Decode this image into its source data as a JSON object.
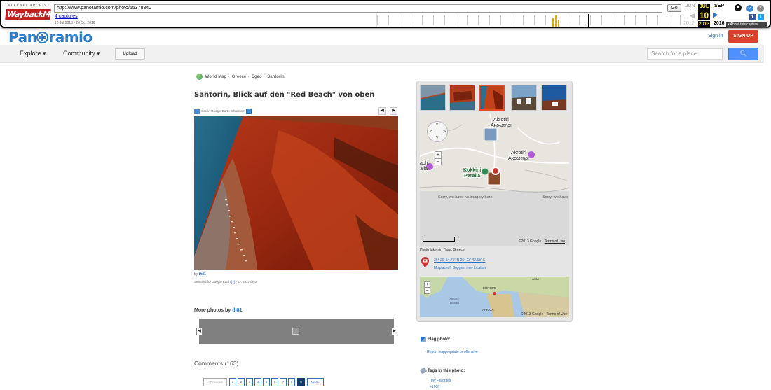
{
  "wayback": {
    "ia_label": "INTERNET ARCHIVE",
    "logo": "WaybackMachine",
    "url": "http://www.panoramio.com/photo/55378840",
    "go_label": "Go",
    "captures": "4 captures",
    "range": "10 Jul 2013 - 20 Oct 2016",
    "months": {
      "prev": "JUN",
      "current": "JUL",
      "next": "SEP"
    },
    "day": "10",
    "years": {
      "prev": "2012",
      "current": "2013",
      "next": "2016"
    },
    "about": "About this capture"
  },
  "header": {
    "logo_pre": "Pan",
    "logo_post": "ramio",
    "signin": "Sign in",
    "signup": "SIGN UP"
  },
  "nav": {
    "explore": "Explore ▾",
    "community": "Community ▾",
    "upload": "Upload",
    "search_placeholder": "Search for a place",
    "search_icon": "search-icon"
  },
  "breadcrumb": [
    "World Map",
    "Greece",
    "Egeo",
    "Santorini"
  ],
  "photo": {
    "title": "Santorin, Blick auf den \"Red Beach\" von oben",
    "see_in_ge": "See in Google Earth",
    "share_on": "Share on:",
    "by_prefix": "by ",
    "author": "th81",
    "selected": "Selected for Google Earth",
    "selected_q": "[?]",
    "id_text": " - ID: 55378840"
  },
  "more_photos": {
    "title_prefix": "More photos by ",
    "author": "th81"
  },
  "comments": {
    "title": "Comments (163)",
    "prev": "« Previous",
    "pages": [
      "1",
      "2",
      "3",
      "4",
      "5",
      "6",
      "7",
      "8",
      "9"
    ],
    "current_page": "9",
    "next": "Next »"
  },
  "side": {
    "map_labels": {
      "akrotiri_top": "Akrotiri\nΑκρωτήρι",
      "akrotiri_right": "Akrotiri\nΑκρωτήρι",
      "kokkini": "Kokkini\nParalia",
      "left_cut": "ach\nalia"
    },
    "no_imagery_1": "Sorry, we have no imagery here.",
    "no_imagery_2": "Sorry, we have",
    "map_copyright": "©2013 Google - ",
    "terms": "Terms of Use",
    "taken": "Photo taken in Thira, Greece",
    "coords": "36° 20' 54.71\" N  25° 23' 42.63\" E",
    "misplaced": "Misplaced? Suggest new location",
    "world_labels": {
      "asia": "ASIA",
      "europe": "EUROPE",
      "atlantic": "Atlantic\nOcean",
      "africa": "AFRICA"
    },
    "world_copyright": "©2013 Google - "
  },
  "flag": {
    "title": "Flag photo:",
    "link": "Report inappropriate or offensive"
  },
  "tags": {
    "title": "Tags in this photo:",
    "items": [
      "\"My Favorites\"",
      "+1000"
    ]
  },
  "colors": {
    "brand_blue": "#2e7bc6",
    "signup_red": "#d8422a",
    "link_blue": "#2e6ec0",
    "search_blue": "#4d90fe"
  }
}
